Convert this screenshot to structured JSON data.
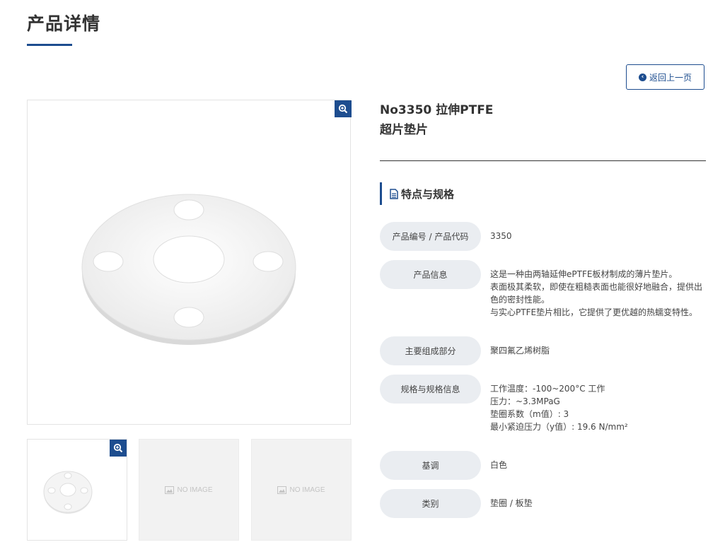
{
  "page": {
    "title": "产品详情"
  },
  "header": {
    "back_label": "返回上一页"
  },
  "gallery": {
    "thumb_placeholder": "NO IMAGE"
  },
  "product": {
    "name_line1": "No3350 拉伸PTFE",
    "name_line2": "超片垫片"
  },
  "section": {
    "title": "特点与规格"
  },
  "specs": [
    {
      "label": "产品编号 / 产品代码",
      "lines": [
        "3350"
      ]
    },
    {
      "label": "产品信息",
      "lines": [
        "这是一种由两轴延伸ePTFE板材制成的薄片垫片。",
        "表面极其柔软，即使在粗糙表面也能很好地融合，提供出",
        "色的密封性能。",
        "与实心PTFE垫片相比，它提供了更优越的热蠕变特性。"
      ]
    },
    {
      "label": "主要组成部分",
      "lines": [
        "聚四氟乙烯树脂"
      ]
    },
    {
      "label": "规格与规格信息",
      "lines": [
        "工作温度：-100~200°C 工作",
        "压力：~3.3MPaG",
        "垫圈系数（m值）: 3",
        "最小紧迫压力（y值）: 19.6 N/mm²"
      ]
    },
    {
      "label": "基调",
      "lines": [
        "白色"
      ]
    },
    {
      "label": "类别",
      "lines": [
        "垫圈 / 板垫"
      ]
    }
  ],
  "colors": {
    "accent": "#1d4d8f",
    "label_bg": "#eaedf1"
  }
}
